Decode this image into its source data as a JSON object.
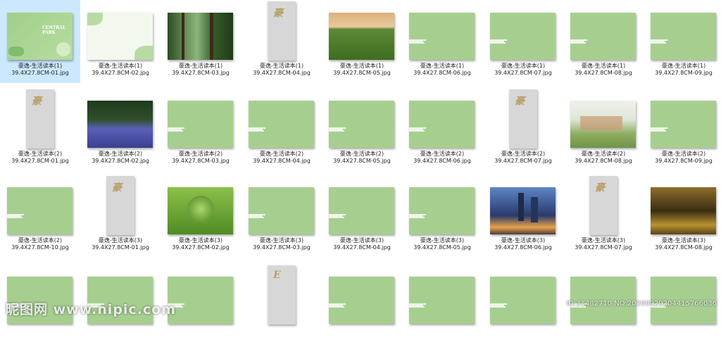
{
  "files": [
    {
      "name1": "豪逸-生活读本(1)",
      "name2": "39.4X27.8CM-01.jpg",
      "kind": "cover",
      "selected": true
    },
    {
      "name1": "豪逸-生活读本(1)",
      "name2": "39.4X27.8CM-02.jpg",
      "kind": "floral"
    },
    {
      "name1": "豪逸-生活读本(1)",
      "name2": "39.4X27.8CM-03.jpg",
      "kind": "forest"
    },
    {
      "name1": "豪逸-生活读本(1)",
      "name2": "39.4X27.8CM-04.jpg",
      "kind": "portrait"
    },
    {
      "name1": "豪逸-生活读本(1)",
      "name2": "39.4X27.8CM-05.jpg",
      "kind": "field"
    },
    {
      "name1": "豪逸-生活读本(1)",
      "name2": "39.4X27.8CM-06.jpg",
      "kind": "layout-girl"
    },
    {
      "name1": "豪逸-生活读本(1)",
      "name2": "39.4X27.8CM-07.jpg",
      "kind": "layout-basket"
    },
    {
      "name1": "豪逸-生活读本(1)",
      "name2": "39.4X27.8CM-08.jpg",
      "kind": "layout-fruit"
    },
    {
      "name1": "豪逸-生活读本(1)",
      "name2": "39.4X27.8CM-09.jpg",
      "kind": "layout-lake"
    },
    {
      "name1": "豪逸-生活读本(2)",
      "name2": "39.4X27.8CM-01.jpg",
      "kind": "portrait"
    },
    {
      "name1": "豪逸-生活读本(2)",
      "name2": "39.4X27.8CM-02.jpg",
      "kind": "bluebell"
    },
    {
      "name1": "豪逸-生活读本(2)",
      "name2": "39.4X27.8CM-03.jpg",
      "kind": "layout-path"
    },
    {
      "name1": "豪逸-生活读本(2)",
      "name2": "39.4X27.8CM-04.jpg",
      "kind": "layout-garden"
    },
    {
      "name1": "豪逸-生活读本(2)",
      "name2": "39.4X27.8CM-05.jpg",
      "kind": "layout-pool"
    },
    {
      "name1": "豪逸-生活读本(2)",
      "name2": "39.4X27.8CM-06.jpg",
      "kind": "layout-room"
    },
    {
      "name1": "豪逸-生活读本(2)",
      "name2": "39.4X27.8CM-07.jpg",
      "kind": "portrait"
    },
    {
      "name1": "豪逸-生活读本(2)",
      "name2": "39.4X27.8CM-08.jpg",
      "kind": "picnic"
    },
    {
      "name1": "豪逸-生活读本(2)",
      "name2": "39.4X27.8CM-09.jpg",
      "kind": "layout-piano"
    },
    {
      "name1": "豪逸-生活读本(2)",
      "name2": "39.4X27.8CM-10.jpg",
      "kind": "layout-tea"
    },
    {
      "name1": "豪逸-生活读本(3)",
      "name2": "39.4X27.8CM-01.jpg",
      "kind": "portrait"
    },
    {
      "name1": "豪逸-生活读本(3)",
      "name2": "39.4X27.8CM-02.jpg",
      "kind": "melon"
    },
    {
      "name1": "豪逸-生活读本(3)",
      "name2": "39.4X27.8CM-03.jpg",
      "kind": "layout-wood"
    },
    {
      "name1": "豪逸-生活读本(3)",
      "name2": "39.4X27.8CM-04.jpg",
      "kind": "layout-woman"
    },
    {
      "name1": "豪逸-生活读本(3)",
      "name2": "39.4X27.8CM-05.jpg",
      "kind": "layout-food"
    },
    {
      "name1": "豪逸-生活读本(3)",
      "name2": "39.4X27.8CM-06.jpg",
      "kind": "city"
    },
    {
      "name1": "豪逸-生活读本(3)",
      "name2": "39.4X27.8CM-07.jpg",
      "kind": "portrait"
    },
    {
      "name1": "豪逸-生活读本(3)",
      "name2": "39.4X27.8CM-08.jpg",
      "kind": "street"
    },
    {
      "name1": "",
      "name2": "",
      "kind": "layout-night"
    },
    {
      "name1": "",
      "name2": "",
      "kind": "layout-reader"
    },
    {
      "name1": "",
      "name2": "",
      "kind": "layout-shop"
    },
    {
      "name1": "",
      "name2": "",
      "kind": "portrait-E"
    },
    {
      "name1": "",
      "name2": "",
      "kind": "layout-lobby"
    },
    {
      "name1": "",
      "name2": "",
      "kind": "layout-green1"
    },
    {
      "name1": "",
      "name2": "",
      "kind": "layout-green2"
    },
    {
      "name1": "",
      "name2": "",
      "kind": "layout-hall"
    },
    {
      "name1": "",
      "name2": "",
      "kind": "layout-bath"
    }
  ],
  "watermark": {
    "left": "昵图网 www.nipic.com",
    "right": "ID:31482710 NO:20200929204415766036"
  },
  "colors": {
    "thumb_green": "#a6cf8f",
    "thumb_gray": "#d7d7d7",
    "selection": "#cce8ff"
  }
}
